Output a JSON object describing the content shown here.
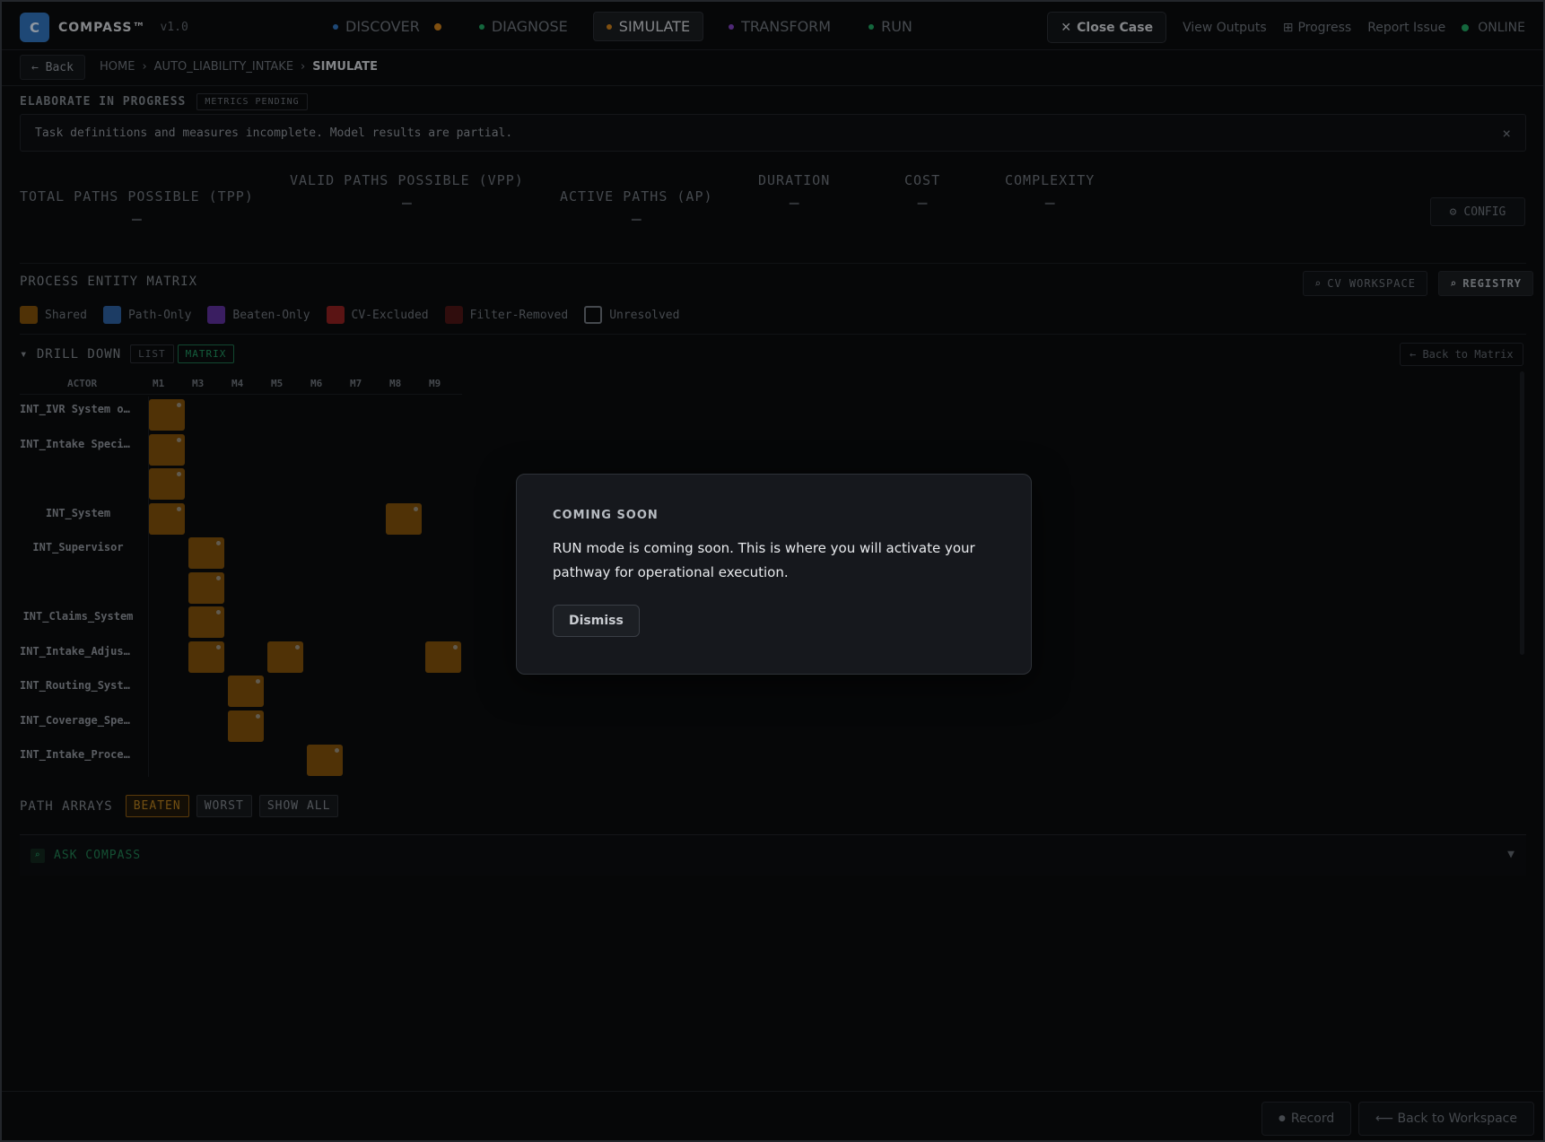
{
  "app": {
    "logo_letter": "C",
    "name": "COMPASS™",
    "version": "v1.0"
  },
  "modes": [
    {
      "label": "DISCOVER",
      "dot": "#2f6fb6",
      "trail_dot": "#c47a1a",
      "active": false
    },
    {
      "label": "DIAGNOSE",
      "dot": "#1f9e5e",
      "trail_dot": "",
      "active": false
    },
    {
      "label": "SIMULATE",
      "dot": "#c47a1a",
      "trail_dot": "",
      "active": true
    },
    {
      "label": "TRANSFORM",
      "dot": "#7a3fb6",
      "trail_dot": "",
      "active": false
    },
    {
      "label": "RUN",
      "dot": "#1f9e5e",
      "trail_dot": "",
      "active": false
    }
  ],
  "topright": {
    "close_case": "Close Case",
    "view_outputs": "View Outputs",
    "progress": "Progress",
    "report_issue": "Report Issue",
    "status": "ONLINE"
  },
  "breadcrumb": {
    "back": "← Back",
    "items": [
      "HOME",
      "AUTO_LIABILITY_INTAKE",
      "SIMULATE"
    ],
    "sep": "›"
  },
  "elaborate": {
    "title": "ELABORATE IN PROGRESS",
    "badge": "METRICS PENDING",
    "alert": "Task definitions and measures incomplete. Model results are partial.",
    "close": "×"
  },
  "metrics": [
    {
      "label": "TOTAL PATHS POSSIBLE (TPP)",
      "value": "—"
    },
    {
      "label": "VALID PATHS POSSIBLE (VPP)",
      "value": "—"
    },
    {
      "label": "ACTIVE PATHS (AP)",
      "value": "—"
    },
    {
      "label": "DURATION",
      "value": "—"
    },
    {
      "label": "COST",
      "value": "—"
    },
    {
      "label": "COMPLEXITY",
      "value": "—"
    }
  ],
  "config_label": "CONFIG",
  "matrix": {
    "title": "PROCESS ENTITY MATRIX",
    "cv_workspace": "CV WORKSPACE",
    "registry": "REGISTRY",
    "legend": [
      {
        "label": "Shared",
        "color": "#7b4d0a",
        "outline": false
      },
      {
        "label": "Path-Only",
        "color": "#2b5c9a",
        "outline": false
      },
      {
        "label": "Beaten-Only",
        "color": "#5a2f96",
        "outline": false
      },
      {
        "label": "CV-Excluded",
        "color": "#8a1f1f",
        "outline": false
      },
      {
        "label": "Filter-Removed",
        "color": "#4a1515",
        "outline": false
      },
      {
        "label": "Unresolved",
        "color": "#0a0b0d",
        "outline": true
      }
    ],
    "drill_title": "▾ DRILL DOWN",
    "view_list": "LIST",
    "view_matrix": "MATRIX",
    "back_to_matrix": "← Back to Matrix",
    "actor_header": "ACTOR",
    "columns": [
      "M1",
      "M3",
      "M4",
      "M5",
      "M6",
      "M7",
      "M8",
      "M9"
    ],
    "rows": [
      {
        "actor": "INT_IVR System o…",
        "cells": [
          "M1"
        ]
      },
      {
        "actor": "INT_Intake Speci…",
        "cells": [
          "M1"
        ]
      },
      {
        "actor": "",
        "cells": [
          "M1"
        ]
      },
      {
        "actor": "INT_System",
        "cells": [
          "M1",
          "M8"
        ]
      },
      {
        "actor": "INT_Supervisor",
        "cells": [
          "M3"
        ]
      },
      {
        "actor": "",
        "cells": [
          "M3"
        ]
      },
      {
        "actor": "INT_Claims_System",
        "cells": [
          "M3"
        ]
      },
      {
        "actor": "INT_Intake_Adjus…",
        "cells": [
          "M3",
          "M5",
          "M9"
        ]
      },
      {
        "actor": "INT_Routing_Syst…",
        "cells": [
          "M4"
        ]
      },
      {
        "actor": "INT_Coverage_Spe…",
        "cells": [
          "M4"
        ]
      },
      {
        "actor": "INT_Intake_Proce…",
        "cells": [
          "M6"
        ]
      }
    ]
  },
  "path_arrays": {
    "title": "PATH ARRAYS",
    "buttons": [
      "BEATEN",
      "WORST",
      "SHOW ALL"
    ]
  },
  "ask": {
    "label": "ASK COMPASS",
    "chevron": "▼"
  },
  "footer": {
    "record": "Record",
    "back_workspace": "⟵ Back to Workspace"
  },
  "modal": {
    "title": "COMING SOON",
    "body": "RUN mode is coming soon. This is where you will activate your pathway for operational execution.",
    "dismiss": "Dismiss"
  }
}
